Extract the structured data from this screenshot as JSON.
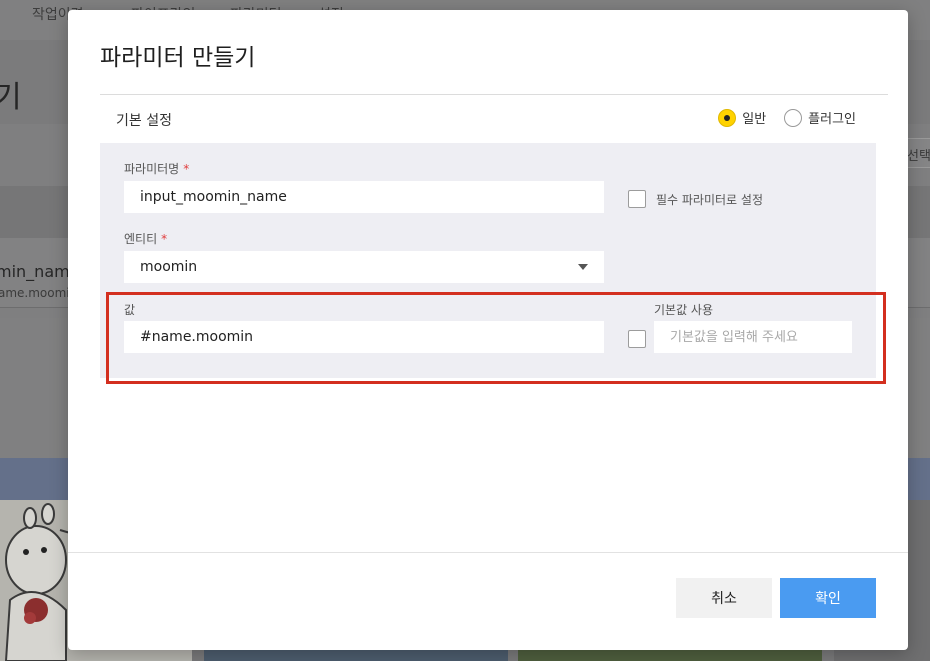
{
  "background": {
    "nav_items": [
      "작업이력",
      "파이프라인",
      "파라미터",
      "설정"
    ],
    "page_title": "기",
    "select_label": "선택",
    "row_name": "min_name",
    "row_sub": "ame.moomin"
  },
  "modal": {
    "title": "파라미터 만들기",
    "section_label": "기본 설정",
    "radio_options": [
      {
        "label": "일반",
        "checked": true
      },
      {
        "label": "플러그인",
        "checked": false
      }
    ],
    "param_name": {
      "label": "파라미터명",
      "required_mark": "*",
      "value": "input_moomin_name"
    },
    "required_checkbox": {
      "label": "필수 파라미터로 설정",
      "checked": false
    },
    "entity": {
      "label": "엔티티",
      "required_mark": "*",
      "value": "moomin"
    },
    "value_field": {
      "label": "값",
      "value": "#name.moomin"
    },
    "default_value": {
      "label": "기본값 사용",
      "checked": false,
      "placeholder": "기본값을 입력해 주세요"
    },
    "buttons": {
      "cancel": "취소",
      "confirm": "확인"
    }
  },
  "colors": {
    "accent_radio": "#ffd200",
    "confirm_button": "#4a9bf1",
    "highlight": "#d32f1f",
    "required": "#e03c3c"
  }
}
